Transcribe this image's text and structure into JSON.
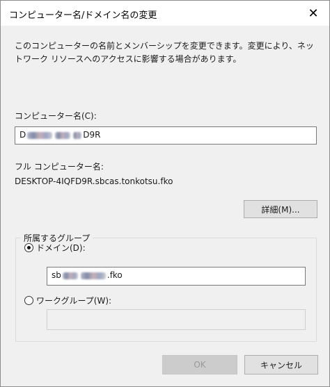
{
  "window": {
    "title": "コンピューター名/ドメイン名の変更",
    "close_symbol": "✕"
  },
  "description": "このコンピューターの名前とメンバーシップを変更できます。変更により、ネットワーク リソースへのアクセスに影響する場合があります。",
  "computer_name": {
    "label": "コンピューター名(C):",
    "value_prefix": "D",
    "value_suffix": "D9R"
  },
  "full_name": {
    "label": "フル コンピューター名:",
    "value": "DESKTOP-4IQFD9R.sbcas.tonkotsu.fko"
  },
  "details_button": "詳細(M)...",
  "membership": {
    "group_title": "所属するグループ",
    "domain_label": "ドメイン(D):",
    "domain_selected": true,
    "domain_value_prefix": "sb",
    "domain_value_suffix": ".fko",
    "workgroup_label": "ワークグループ(W):",
    "workgroup_selected": false,
    "workgroup_value": ""
  },
  "buttons": {
    "ok": "OK",
    "cancel": "キャンセル"
  }
}
